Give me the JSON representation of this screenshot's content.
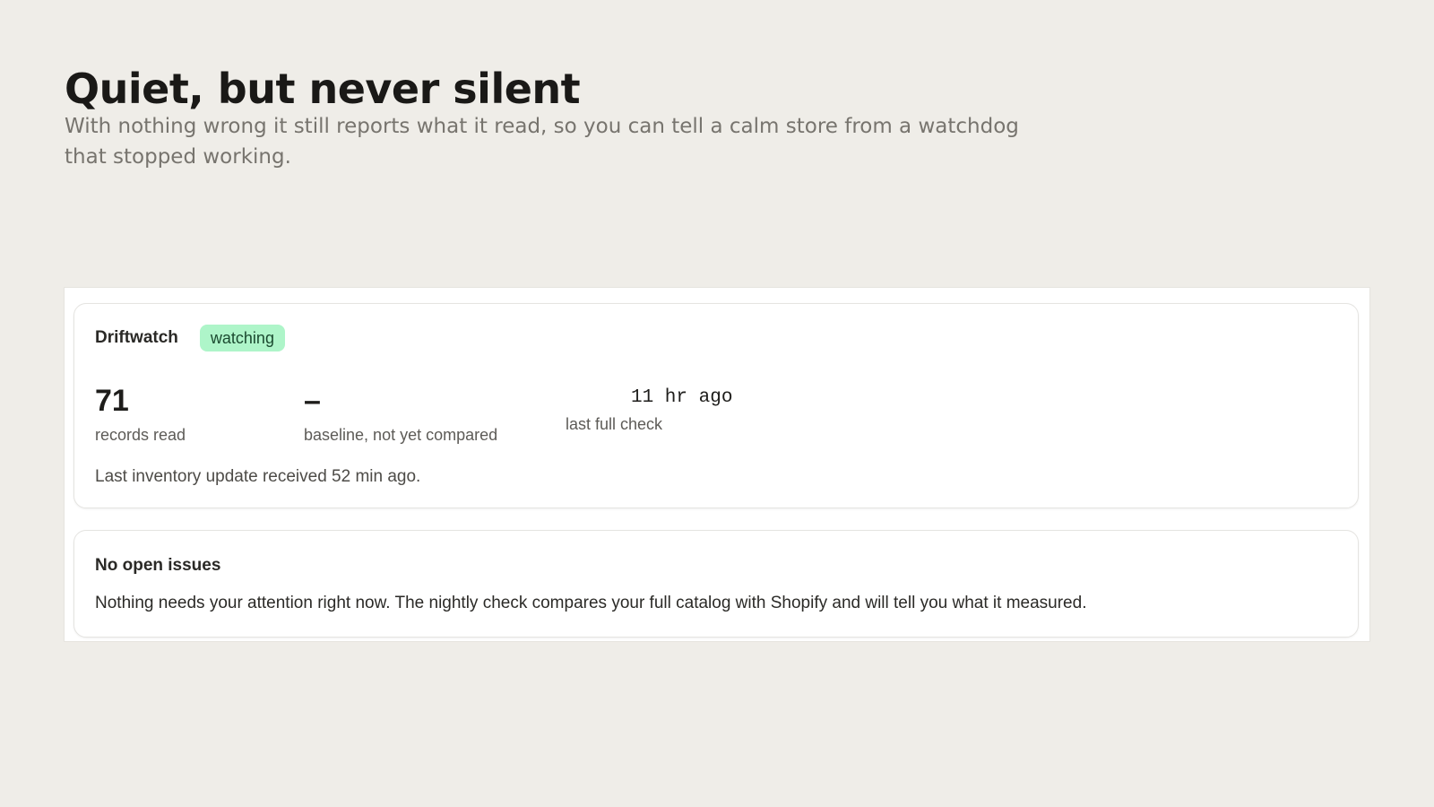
{
  "hero": {
    "title": "Quiet, but never silent",
    "subtitle": "With nothing wrong it still reports what it read, so you can tell a calm store from a watchdog that stopped working."
  },
  "status_card": {
    "app_name": "Driftwatch",
    "badge": "watching",
    "badge_color": "#aef5c9",
    "metrics": [
      {
        "value": "71",
        "label": "records read"
      },
      {
        "value": "–",
        "label": "baseline, not yet compared"
      },
      {
        "value": "11 hr ago",
        "label": "last full check"
      }
    ],
    "update_note": "Last inventory update received 52 min ago."
  },
  "issues_card": {
    "title": "No open issues",
    "body": "Nothing needs your attention right now. The nightly check compares your full catalog with Shopify and will tell you what it measured."
  }
}
